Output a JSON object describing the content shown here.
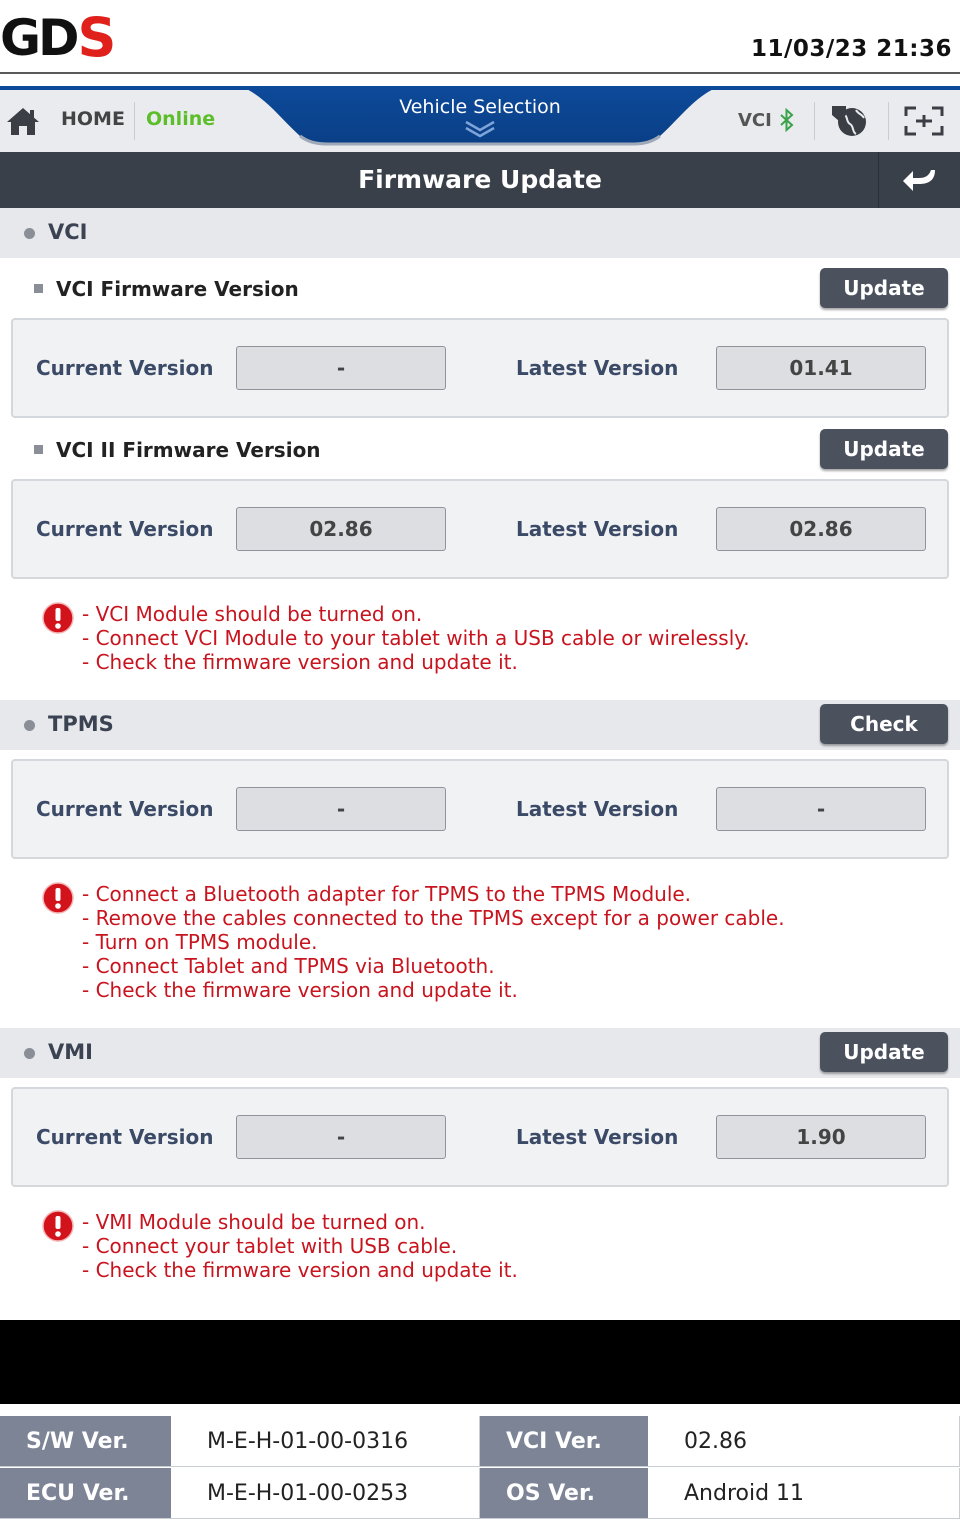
{
  "header": {
    "logo": "GDS",
    "datetime": "11/03/23 21:36"
  },
  "nav": {
    "home_label": "HOME",
    "online_label": "Online",
    "vehicle_selection_label": "Vehicle Selection",
    "vci_label": "VCI",
    "icons": [
      "home-icon",
      "chevron-down-icon",
      "bluetooth-icon",
      "globe-icon",
      "scan-icon"
    ]
  },
  "title": {
    "text": "Firmware Update"
  },
  "vci": {
    "section_label": "VCI",
    "fw1": {
      "label": "VCI Firmware Version",
      "button": "Update",
      "current_label": "Current Version",
      "current_value": "-",
      "latest_label": "Latest Version",
      "latest_value": "01.41"
    },
    "fw2": {
      "label": "VCI II Firmware Version",
      "button": "Update",
      "current_label": "Current Version",
      "current_value": "02.86",
      "latest_label": "Latest Version",
      "latest_value": "02.86"
    },
    "warnings": [
      "- VCI Module should be turned on.",
      "- Connect VCI Module to your tablet with a USB cable or wirelessly.",
      "- Check the firmware version and update it."
    ]
  },
  "tpms": {
    "section_label": "TPMS",
    "button": "Check",
    "current_label": "Current Version",
    "current_value": "-",
    "latest_label": "Latest Version",
    "latest_value": "-",
    "warnings": [
      "- Connect a Bluetooth adapter for TPMS to the TPMS Module.",
      "- Remove the cables connected to the TPMS except for a power cable.",
      "- Turn on TPMS module.",
      "- Connect Tablet and TPMS via Bluetooth.",
      "- Check the firmware version and update it."
    ]
  },
  "vmi": {
    "section_label": "VMI",
    "button": "Update",
    "current_label": "Current Version",
    "current_value": "-",
    "latest_label": "Latest Version",
    "latest_value": "1.90",
    "warnings": [
      "- VMI Module should be turned on.",
      "- Connect your tablet with USB cable.",
      "- Check the firmware version and update it."
    ]
  },
  "footer": {
    "sw_key": "S/W Ver.",
    "sw_val": "M-E-H-01-00-0316",
    "vci_key": "VCI Ver.",
    "vci_val": "02.86",
    "ecu_key": "ECU Ver.",
    "ecu_val": "M-E-H-01-00-0253",
    "os_key": "OS Ver.",
    "os_val": "Android 11"
  },
  "colors": {
    "accent_blue": "#0d4a9a",
    "online_green": "#5cbf2a",
    "title_bar": "#3a4049",
    "button": "#4b525d",
    "warning_red": "#c8141e",
    "footer_key": "#7c8496"
  }
}
